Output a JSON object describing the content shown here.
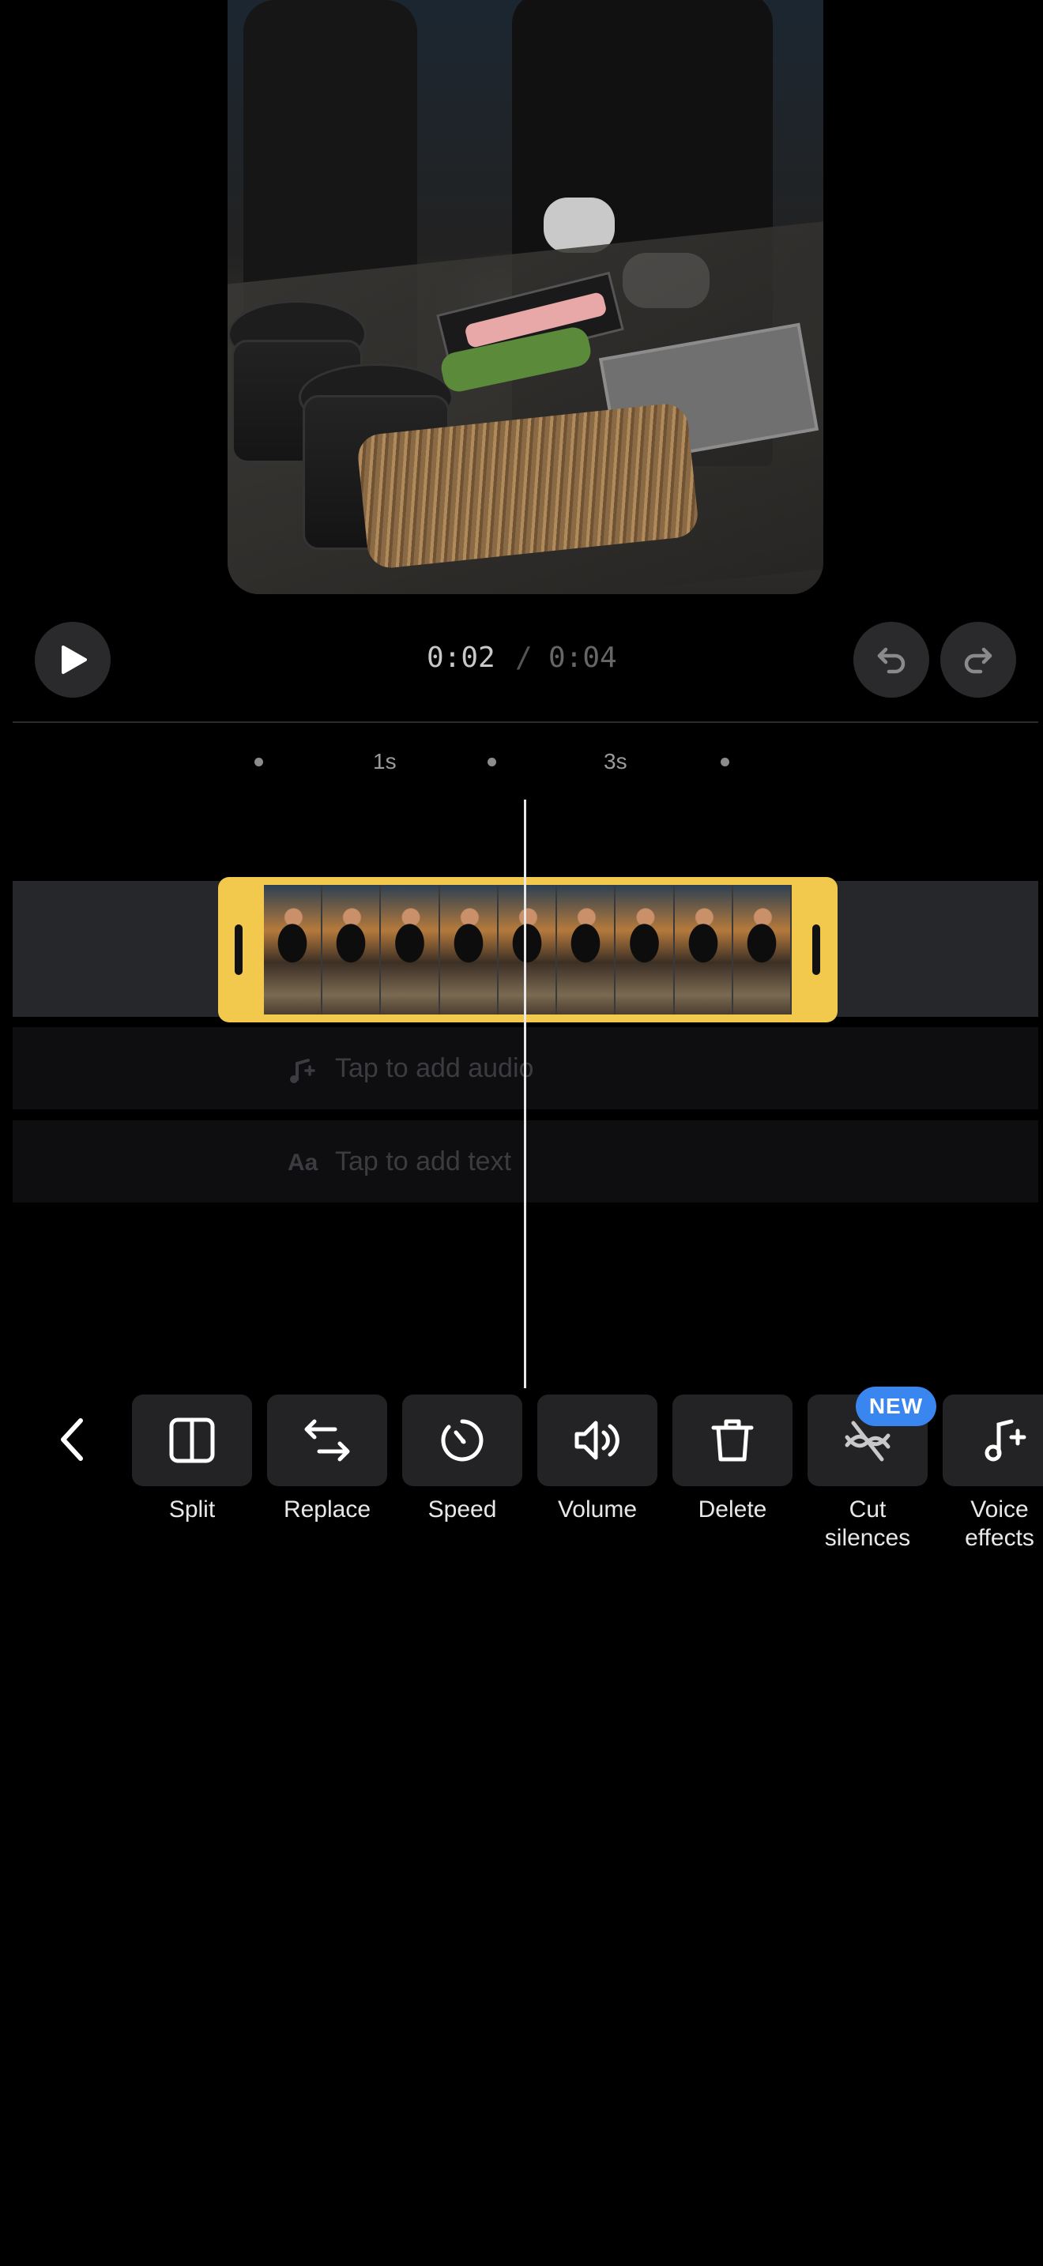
{
  "player": {
    "current_time": "0:02",
    "separator": "/",
    "total_time": "0:04"
  },
  "ruler": {
    "labels": [
      "1s",
      "3s"
    ]
  },
  "timeline": {
    "audio_lane_label": "Tap to add audio",
    "text_lane_label": "Tap to add text",
    "text_lane_icon_label": "Aa"
  },
  "toolbar": {
    "tools": [
      {
        "label": "Split",
        "icon": "split-icon"
      },
      {
        "label": "Replace",
        "icon": "replace-icon"
      },
      {
        "label": "Speed",
        "icon": "speed-icon"
      },
      {
        "label": "Volume",
        "icon": "volume-icon"
      },
      {
        "label": "Delete",
        "icon": "trash-icon"
      },
      {
        "label": "Cut silences",
        "label_line1": "Cut",
        "label_line2": "silences",
        "icon": "cut-silences-icon",
        "badge": "NEW"
      },
      {
        "label": "Voice effects",
        "label_line1": "Voice",
        "label_line2": "effects",
        "icon": "voice-effects-icon"
      }
    ]
  },
  "colors": {
    "clip_accent": "#f2c94c",
    "badge": "#3a86f0",
    "background": "#000000"
  }
}
